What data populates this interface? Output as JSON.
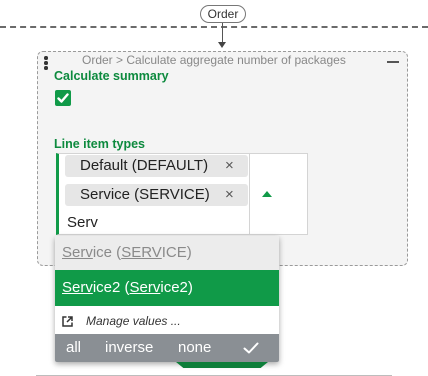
{
  "canvas": {
    "order_pill": "Order"
  },
  "card": {
    "breadcrumb": "Order > Calculate aggregate number of packages",
    "calculate_summary_label": "Calculate summary",
    "calculate_summary_checked": true,
    "line_item_types_label": "Line item types"
  },
  "multiselect": {
    "chips": [
      {
        "label": "Default (DEFAULT)",
        "remove_icon": "×"
      },
      {
        "label": "Service (SERVICE)",
        "remove_icon": "×"
      }
    ],
    "typed_value": "Serv",
    "toggle_icon": "caret-up-icon"
  },
  "dropdown": {
    "options": [
      {
        "prefix": "Serv",
        "rest": "ice (",
        "match2": "SERV",
        "rest2": "ICE)",
        "state": "disabled"
      },
      {
        "prefix": "Serv",
        "rest": "ice2 (",
        "match2": "Serv",
        "rest2": "ice2)",
        "state": "highlighted"
      }
    ],
    "manage_values": "Manage values ...",
    "actions": {
      "all": "all",
      "inverse": "inverse",
      "none": "none"
    }
  },
  "colors": {
    "accent": "#109a48",
    "label_green": "#0d8a3e",
    "action_bar": "#8a8f94"
  }
}
